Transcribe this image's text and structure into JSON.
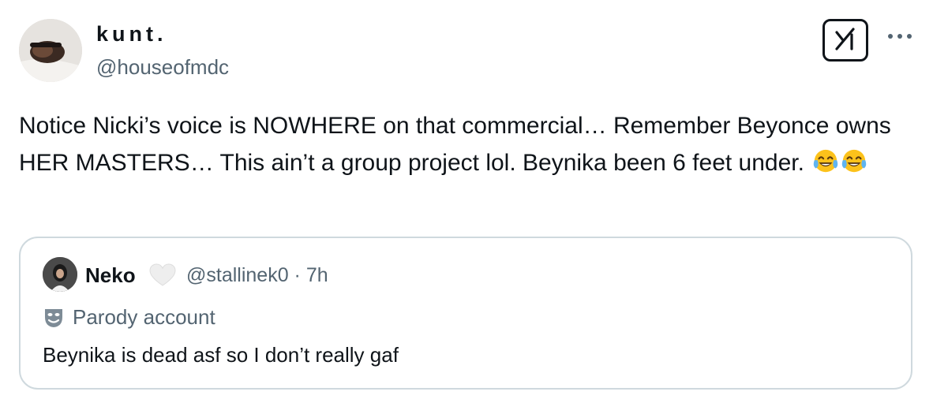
{
  "author": {
    "display_name": "kunt.",
    "handle": "@houseofmdc",
    "avatar_icon": "profile-photo"
  },
  "header": {
    "grok_icon": "grok-icon",
    "more_icon": "more-options-icon"
  },
  "tweet": {
    "text": "Notice Nicki’s voice is NOWHERE on that commercial… Remember Beyonce owns HER MASTERS… This ain’t a group project lol. Beynika been 6 feet under.",
    "emojis": [
      "face-with-tears-of-joy",
      "face-with-tears-of-joy"
    ]
  },
  "quoted_tweet": {
    "display_name": "Neko",
    "name_badge_icon": "white-heart-icon",
    "handle_time": "@stallinek0 · 7h",
    "parody_label": "Parody account",
    "parody_icon": "theater-mask-icon",
    "text": "Beynika is dead asf so I don’t really gaf"
  }
}
